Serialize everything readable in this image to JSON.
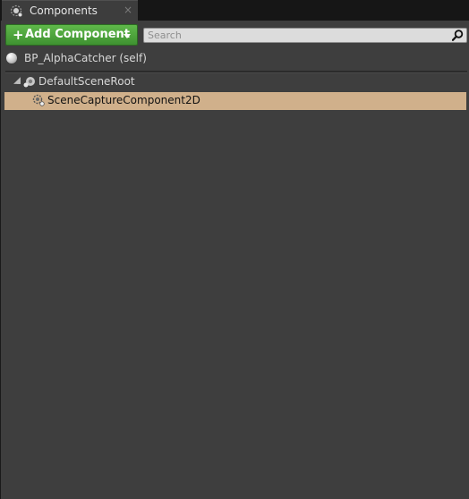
{
  "tab": {
    "title": "Components",
    "icon": "components-icon",
    "close_glyph": "×"
  },
  "toolbar": {
    "add_plus": "+",
    "add_label": "Add Component",
    "search_placeholder": "Search",
    "search_value": ""
  },
  "self_row": {
    "label": "BP_AlphaCatcher (self)",
    "icon": "sphere-icon"
  },
  "tree": {
    "items": [
      {
        "label": "DefaultSceneRoot",
        "icon": "scene-root-icon",
        "expanded": true,
        "selected": false
      },
      {
        "label": "SceneCaptureComponent2D",
        "icon": "scene-capture-icon",
        "expanded": false,
        "selected": true
      }
    ]
  },
  "colors": {
    "panel_bg": "#3e3e3e",
    "tab_bg": "#3d3d3d",
    "add_button": "#4ea83c",
    "selected_row": "#d0b08b"
  }
}
